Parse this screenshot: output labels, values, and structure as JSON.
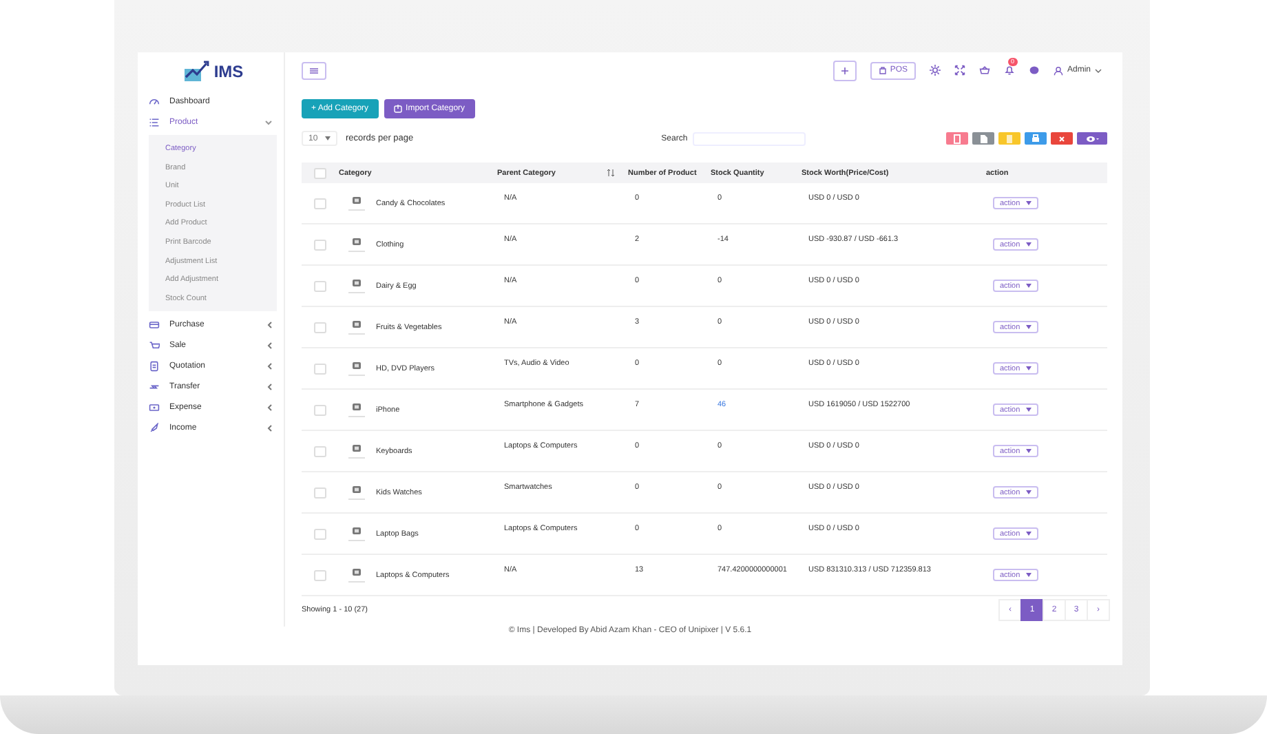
{
  "sidebar": {
    "logo": "IMS",
    "items": [
      {
        "label": "Dashboard",
        "kind": "link",
        "selected": false
      },
      {
        "label": "Product",
        "kind": "menu",
        "selected": true,
        "expanded": true,
        "children": [
          {
            "label": "Category",
            "selected": true
          },
          {
            "label": "Brand",
            "selected": false
          },
          {
            "label": "Unit",
            "selected": false
          },
          {
            "label": "Product List",
            "selected": false
          },
          {
            "label": "Add Product",
            "selected": false
          },
          {
            "label": "Print Barcode",
            "selected": false
          },
          {
            "label": "Adjustment List",
            "selected": false
          },
          {
            "label": "Add Adjustment",
            "selected": false
          },
          {
            "label": "Stock Count",
            "selected": false
          }
        ]
      },
      {
        "label": "Purchase",
        "kind": "menu",
        "selected": false,
        "expanded": false
      },
      {
        "label": "Sale",
        "kind": "menu",
        "selected": false,
        "expanded": false
      },
      {
        "label": "Quotation",
        "kind": "menu",
        "selected": false,
        "expanded": false
      },
      {
        "label": "Transfer",
        "kind": "menu",
        "selected": false,
        "expanded": false
      },
      {
        "label": "Expense",
        "kind": "menu",
        "selected": false,
        "expanded": false
      },
      {
        "label": "Income",
        "kind": "menu",
        "selected": false,
        "expanded": false
      }
    ]
  },
  "topbar": {
    "pos_label": "POS",
    "notification_badge": "0",
    "user": "Admin"
  },
  "toolbar": {
    "add_button": "+ Add Category",
    "import_button": "Import Category"
  },
  "table_controls": {
    "page_size": "10",
    "page_size_label": "records per page",
    "search_label": "Search",
    "export_buttons": [
      {
        "kind": "pdf",
        "color": "#f77b8f"
      },
      {
        "kind": "csv",
        "color": "#8a9096"
      },
      {
        "kind": "excel",
        "color": "#f8c62a"
      },
      {
        "kind": "print",
        "color": "#3d9be9"
      },
      {
        "kind": "delete",
        "color": "#e9463c"
      },
      {
        "kind": "columns",
        "color": "#7c5cc4"
      }
    ]
  },
  "table": {
    "columns": [
      {
        "label": "Category"
      },
      {
        "label": "Parent Category",
        "sortable": true
      },
      {
        "label": "Number of Product"
      },
      {
        "label": "Stock Quantity"
      },
      {
        "label": "Stock Worth(Price/Cost)"
      },
      {
        "label": "action"
      }
    ],
    "all_checked": false,
    "rows": [
      {
        "checked": false,
        "name": "Candy & Chocolates",
        "parent": "N/A",
        "products": "0",
        "quantity": "0",
        "quantity_link": false,
        "worth": "USD 0 / USD 0",
        "action": "action"
      },
      {
        "checked": false,
        "name": "Clothing",
        "parent": "N/A",
        "products": "2",
        "quantity": "-14",
        "quantity_link": false,
        "worth": "USD -930.87 / USD -661.3",
        "action": "action"
      },
      {
        "checked": false,
        "name": "Dairy & Egg",
        "parent": "N/A",
        "products": "0",
        "quantity": "0",
        "quantity_link": false,
        "worth": "USD 0 / USD 0",
        "action": "action"
      },
      {
        "checked": false,
        "name": "Fruits & Vegetables",
        "parent": "N/A",
        "products": "3",
        "quantity": "0",
        "quantity_link": false,
        "worth": "USD 0 / USD 0",
        "action": "action"
      },
      {
        "checked": false,
        "name": "HD, DVD Players",
        "parent": "TVs, Audio & Video",
        "products": "0",
        "quantity": "0",
        "quantity_link": false,
        "worth": "USD 0 / USD 0",
        "action": "action"
      },
      {
        "checked": false,
        "name": "iPhone",
        "parent": "Smartphone & Gadgets",
        "products": "7",
        "quantity": "46",
        "quantity_link": true,
        "worth": "USD 1619050 / USD 1522700",
        "action": "action"
      },
      {
        "checked": false,
        "name": "Keyboards",
        "parent": "Laptops & Computers",
        "products": "0",
        "quantity": "0",
        "quantity_link": false,
        "worth": "USD 0 / USD 0",
        "action": "action"
      },
      {
        "checked": false,
        "name": "Kids Watches",
        "parent": "Smartwatches",
        "products": "0",
        "quantity": "0",
        "quantity_link": false,
        "worth": "USD 0 / USD 0",
        "action": "action"
      },
      {
        "checked": false,
        "name": "Laptop Bags",
        "parent": "Laptops & Computers",
        "products": "0",
        "quantity": "0",
        "quantity_link": false,
        "worth": "USD 0 / USD 0",
        "action": "action"
      },
      {
        "checked": false,
        "name": "Laptops & Computers",
        "parent": "N/A",
        "products": "13",
        "quantity": "747.4200000000001",
        "quantity_link": false,
        "worth": "USD 831310.313 / USD 712359.813",
        "action": "action"
      }
    ]
  },
  "summary": "Showing 1 - 10 (27)",
  "pagination": [
    {
      "label": "‹",
      "selected": false
    },
    {
      "label": "1",
      "selected": true
    },
    {
      "label": "2",
      "selected": false
    },
    {
      "label": "3",
      "selected": false
    },
    {
      "label": "›",
      "selected": false
    }
  ],
  "footer": "© Ims | Developed By Abid Azam Khan - CEO of Unipixer | V 5.6.1"
}
